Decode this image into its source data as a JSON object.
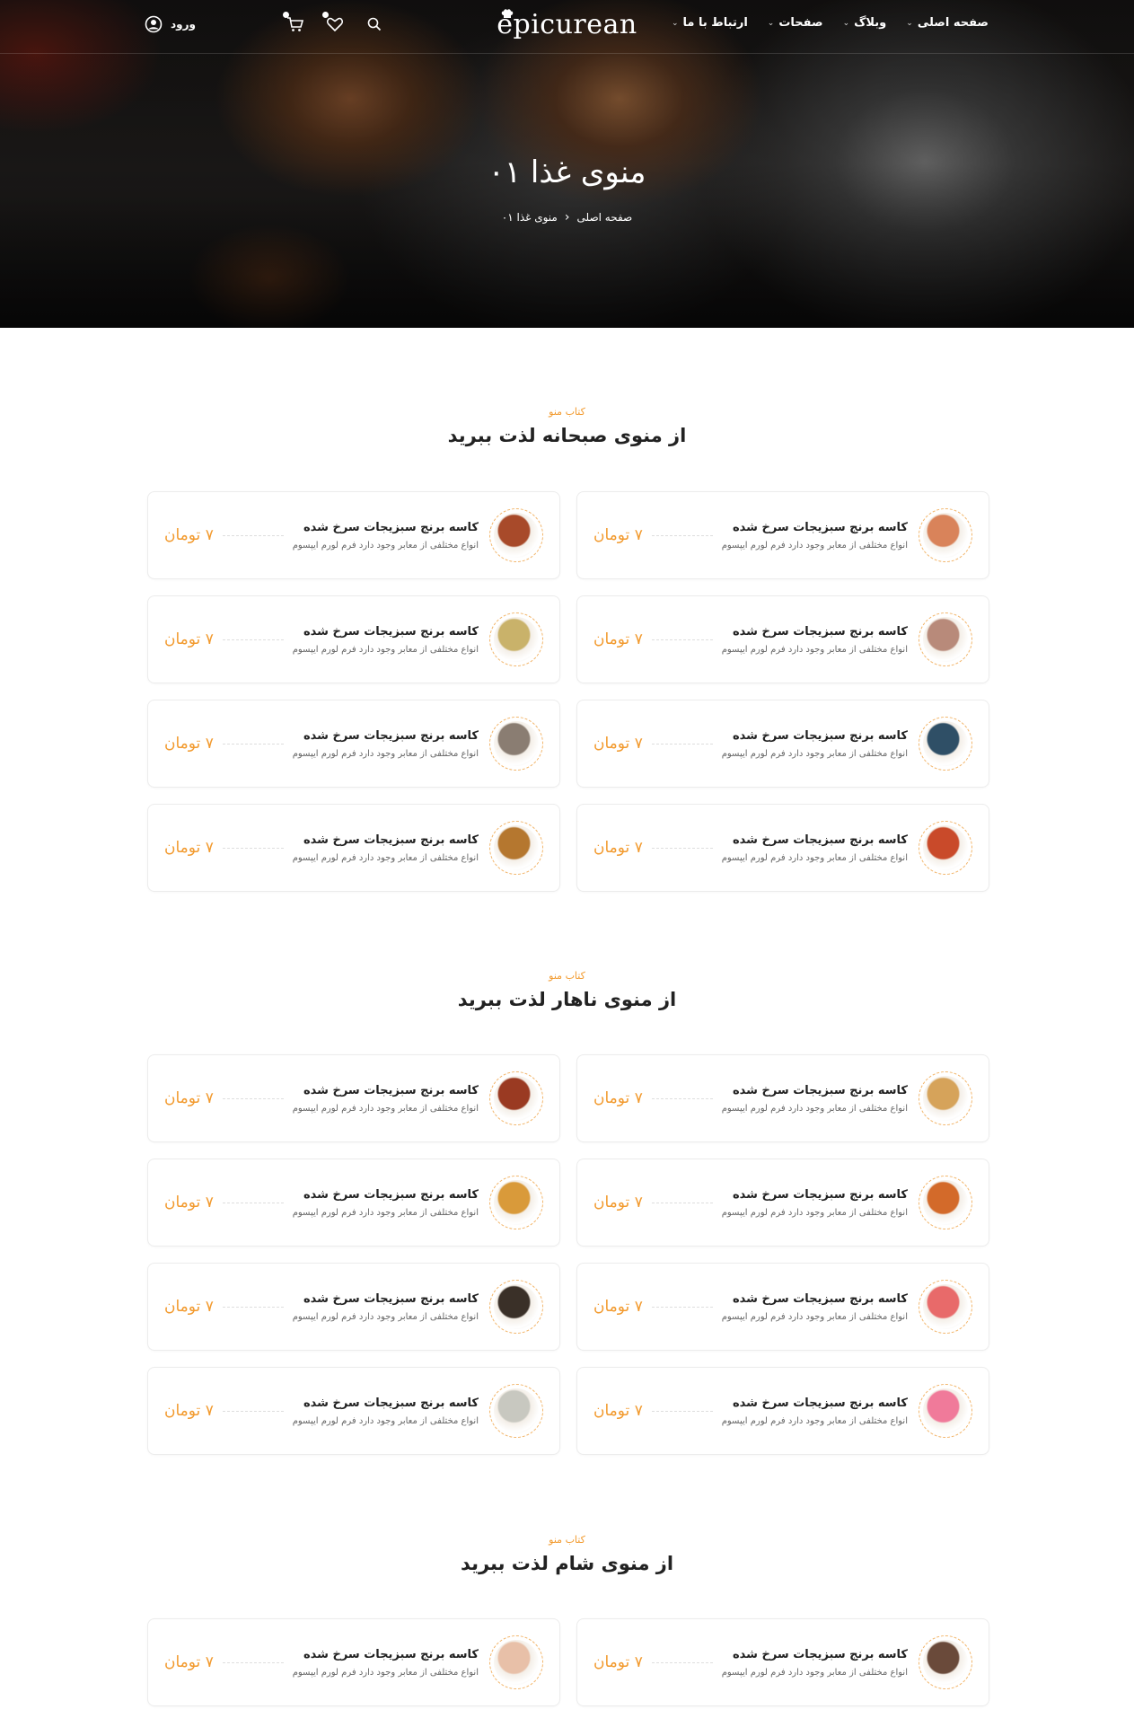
{
  "header": {
    "logo": "epicurean",
    "nav": [
      {
        "label": "صفحه اصلی",
        "has_dropdown": true
      },
      {
        "label": "وبلاگ",
        "has_dropdown": true
      },
      {
        "label": "صفحات",
        "has_dropdown": true
      },
      {
        "label": "ارتباط با ما",
        "has_dropdown": true
      }
    ],
    "login_label": "ورود",
    "icons": [
      "cart-icon",
      "heart-icon",
      "search-icon",
      "user-icon"
    ]
  },
  "hero": {
    "title": "منوی غذا ۰۱",
    "breadcrumb": {
      "home": "صفحه اصلی",
      "current": "منوی غذا ۰۱"
    }
  },
  "sections": [
    {
      "eyebrow": "کتاب منو",
      "title": "از منوی صبحانه لذت ببرید",
      "items": [
        {
          "name": "کاسه برنج سبزیجات سرخ شده",
          "desc": "انواع مختلفی از معابر وجود دارد فرم لورم ایپسوم",
          "price": "۷ تومان",
          "plate": "#d9835a"
        },
        {
          "name": "کاسه برنج سبزیجات سرخ شده",
          "desc": "انواع مختلفی از معابر وجود دارد فرم لورم ایپسوم",
          "price": "۷ تومان",
          "plate": "#a84a2a"
        },
        {
          "name": "کاسه برنج سبزیجات سرخ شده",
          "desc": "انواع مختلفی از معابر وجود دارد فرم لورم ایپسوم",
          "price": "۷ تومان",
          "plate": "#b88a7a"
        },
        {
          "name": "کاسه برنج سبزیجات سرخ شده",
          "desc": "انواع مختلفی از معابر وجود دارد فرم لورم ایپسوم",
          "price": "۷ تومان",
          "plate": "#c9b26a"
        },
        {
          "name": "کاسه برنج سبزیجات سرخ شده",
          "desc": "انواع مختلفی از معابر وجود دارد فرم لورم ایپسوم",
          "price": "۷ تومان",
          "plate": "#2f4f66"
        },
        {
          "name": "کاسه برنج سبزیجات سرخ شده",
          "desc": "انواع مختلفی از معابر وجود دارد فرم لورم ایپسوم",
          "price": "۷ تومان",
          "plate": "#8a7d72"
        },
        {
          "name": "کاسه برنج سبزیجات سرخ شده",
          "desc": "انواع مختلفی از معابر وجود دارد فرم لورم ایپسوم",
          "price": "۷ تومان",
          "plate": "#c94a2a"
        },
        {
          "name": "کاسه برنج سبزیجات سرخ شده",
          "desc": "انواع مختلفی از معابر وجود دارد فرم لورم ایپسوم",
          "price": "۷ تومان",
          "plate": "#b5772f"
        }
      ]
    },
    {
      "eyebrow": "کتاب منو",
      "title": "از منوی ناهار لذت ببرید",
      "items": [
        {
          "name": "کاسه برنج سبزیجات سرخ شده",
          "desc": "انواع مختلفی از معابر وجود دارد فرم لورم ایپسوم",
          "price": "۷ تومان",
          "plate": "#d6a35a"
        },
        {
          "name": "کاسه برنج سبزیجات سرخ شده",
          "desc": "انواع مختلفی از معابر وجود دارد فرم لورم ایپسوم",
          "price": "۷ تومان",
          "plate": "#9a3a22"
        },
        {
          "name": "کاسه برنج سبزیجات سرخ شده",
          "desc": "انواع مختلفی از معابر وجود دارد فرم لورم ایپسوم",
          "price": "۷ تومان",
          "plate": "#d36a2a"
        },
        {
          "name": "کاسه برنج سبزیجات سرخ شده",
          "desc": "انواع مختلفی از معابر وجود دارد فرم لورم ایپسوم",
          "price": "۷ تومان",
          "plate": "#d99a3a"
        },
        {
          "name": "کاسه برنج سبزیجات سرخ شده",
          "desc": "انواع مختلفی از معابر وجود دارد فرم لورم ایپسوم",
          "price": "۷ تومان",
          "plate": "#e86a6a"
        },
        {
          "name": "کاسه برنج سبزیجات سرخ شده",
          "desc": "انواع مختلفی از معابر وجود دارد فرم لورم ایپسوم",
          "price": "۷ تومان",
          "plate": "#3a3028"
        },
        {
          "name": "کاسه برنج سبزیجات سرخ شده",
          "desc": "انواع مختلفی از معابر وجود دارد فرم لورم ایپسوم",
          "price": "۷ تومان",
          "plate": "#f07a9a"
        },
        {
          "name": "کاسه برنج سبزیجات سرخ شده",
          "desc": "انواع مختلفی از معابر وجود دارد فرم لورم ایپسوم",
          "price": "۷ تومان",
          "plate": "#c8c8c0"
        }
      ]
    },
    {
      "eyebrow": "کتاب منو",
      "title": "از منوی شام لذت ببرید",
      "items": [
        {
          "name": "کاسه برنج سبزیجات سرخ شده",
          "desc": "انواع مختلفی از معابر وجود دارد فرم لورم ایپسوم",
          "price": "۷ تومان",
          "plate": "#6a4a3a"
        },
        {
          "name": "کاسه برنج سبزیجات سرخ شده",
          "desc": "انواع مختلفی از معابر وجود دارد فرم لورم ایپسوم",
          "price": "۷ تومان",
          "plate": "#e8c0a8"
        }
      ]
    }
  ]
}
